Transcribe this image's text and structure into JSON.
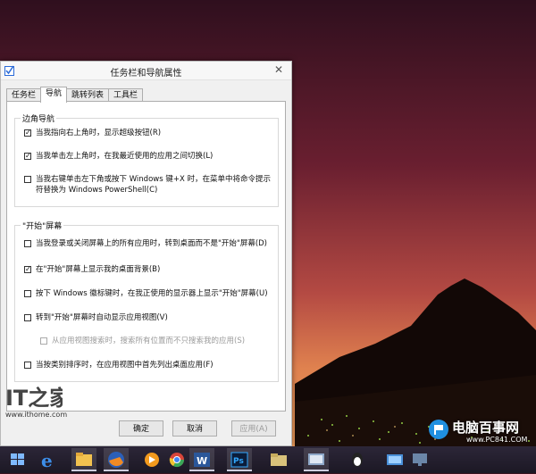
{
  "window": {
    "title": "任务栏和导航属性"
  },
  "tabs": [
    {
      "label": "任务栏"
    },
    {
      "label": "导航"
    },
    {
      "label": "跳转列表"
    },
    {
      "label": "工具栏"
    }
  ],
  "corner_nav": {
    "label": "边角导航",
    "options": [
      {
        "label": "当我指向右上角时，显示超级按钮(R)",
        "checked": true
      },
      {
        "label": "当我单击左上角时，在我最近使用的应用之间切换(L)",
        "checked": true
      },
      {
        "label": "当我右键单击左下角或按下 Windows 键+X 时，在菜单中将命令提示符替换为 Windows PowerShell(C)",
        "checked": false
      }
    ]
  },
  "start_screen": {
    "label": "\"开始\"屏幕",
    "options": [
      {
        "label": "当我登录或关闭屏幕上的所有应用时，转到桌面而不是\"开始\"屏幕(D)",
        "checked": false
      },
      {
        "label": "在\"开始\"屏幕上显示我的桌面背景(B)",
        "checked": true
      },
      {
        "label": "按下 Windows 徽标键时，在我正使用的显示器上显示\"开始\"屏幕(U)",
        "checked": false
      },
      {
        "label": "转到\"开始\"屏幕时自动显示应用视图(V)",
        "checked": false
      },
      {
        "label": "从应用视图搜索时，搜索所有位置而不只搜索我的应用(S)",
        "checked": false,
        "disabled": true
      },
      {
        "label": "当按类别排序时，在应用视图中首先列出桌面应用(F)",
        "checked": false
      }
    ]
  },
  "buttons": {
    "ok": "确定",
    "cancel": "取消",
    "apply": "应用(A)"
  },
  "watermark_ithome": {
    "logo": "IT之家",
    "url": "www.ithome.com"
  },
  "watermark_pc": {
    "name": "电脑百事网",
    "url": "www.PC841.COM"
  },
  "taskbar": {
    "icons": [
      "windows-explorer-icon",
      "internet-explorer-icon",
      "file-explorer-icon",
      "firefox-icon",
      "media-player-icon",
      "chrome-icon",
      "word-icon",
      "photoshop-icon",
      "folder-icon",
      "control-panel-icon",
      "qq-icon",
      "network-icon",
      "monitor-icon"
    ]
  },
  "colors": {
    "sky_top": "#3b1323",
    "sky_horizon": "#e88555",
    "mountain": "#120806",
    "city_lights": "#7ecf3c",
    "taskbar": "#221c2c",
    "accent": "#2a6ad8"
  }
}
